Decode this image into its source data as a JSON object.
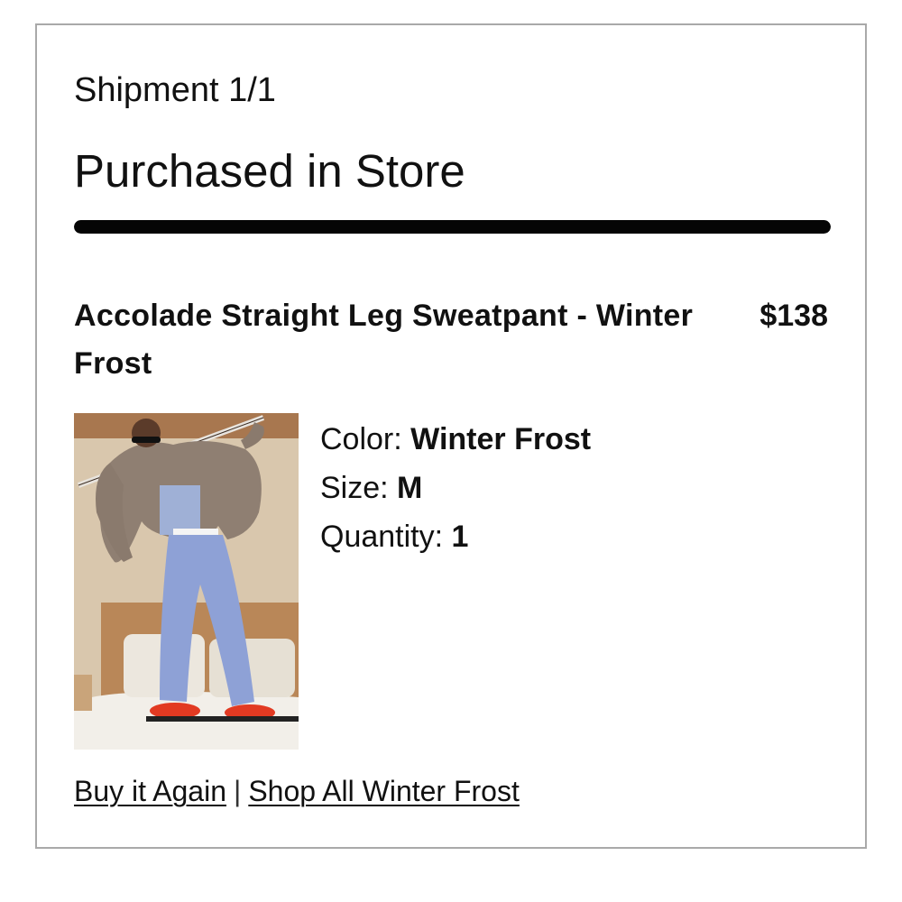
{
  "shipment": {
    "label": "Shipment 1/1",
    "title": "Purchased in Store",
    "progress_fraction": 1.0
  },
  "product": {
    "name": "Accolade Straight Leg Sweatpant - Winter Frost",
    "price": "$138",
    "image_alt": "Model wearing Accolade Straight Leg Sweatpant in Winter Frost",
    "details": [
      {
        "label": "Color:",
        "value": "Winter Frost"
      },
      {
        "label": "Size:",
        "value": "M"
      },
      {
        "label": "Quantity:",
        "value": "1"
      }
    ]
  },
  "actions": {
    "buy_again": "Buy it Again",
    "separator": "|",
    "shop_all": "Shop All Winter Frost"
  },
  "colors": {
    "text": "#111111",
    "border": "#a9a9a9",
    "progress": "#050505"
  }
}
